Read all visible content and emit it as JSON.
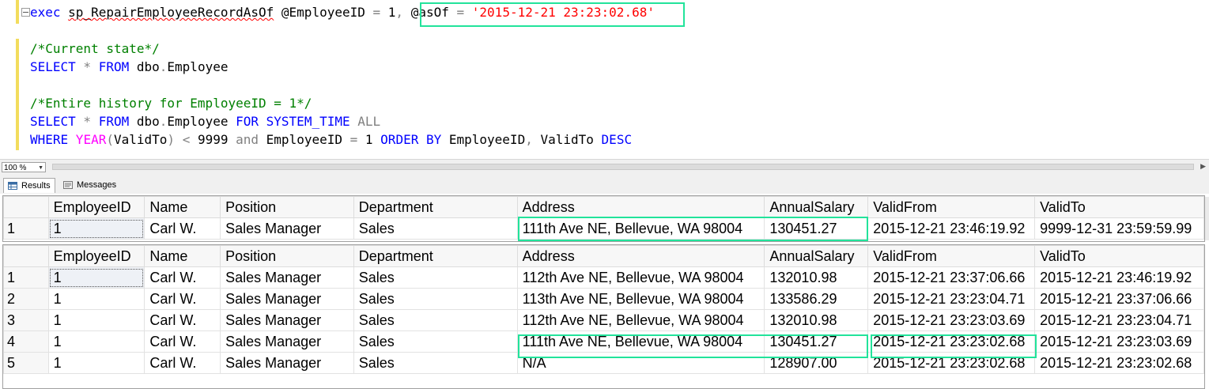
{
  "editor": {
    "line1": {
      "exec": "exec",
      "proc": "sp_RepairEmployeeRecordAsOf",
      "param1": "@EmployeeID",
      "eq1": " = ",
      "val1": "1",
      "comma": ",",
      "param2": "@asOf",
      "eq2": " = ",
      "val2": "'2015-12-21 23:23:02.68'"
    },
    "line3_comment": "/*Current state*/",
    "line4": {
      "select": "SELECT",
      "star": " * ",
      "from": "FROM",
      "table": " dbo",
      "dot": ".",
      "name": "Employee"
    },
    "line6_comment": "/*Entire history for EmployeeID = 1*/",
    "line7": {
      "select": "SELECT",
      "star": " * ",
      "from": "FROM",
      "table": " dbo",
      "dot": ".",
      "name": "Employee ",
      "for": "FOR",
      "systime": " SYSTEM_TIME ",
      "all": "ALL"
    },
    "line8": {
      "where": "WHERE",
      "year": " YEAR",
      "open": "(",
      "col": "ValidTo",
      "close": ") ",
      "lt": "<",
      "num": " 9999 ",
      "and": "and",
      "rest": " EmployeeID ",
      "eq": "=",
      "one": " 1 ",
      "orderby": "ORDER BY",
      "cols": " EmployeeID",
      "comma": ",",
      "col2": " ValidTo ",
      "desc": "DESC"
    }
  },
  "zoom": {
    "value": "100 %"
  },
  "tabs": {
    "results": "Results",
    "messages": "Messages"
  },
  "columns": [
    "EmployeeID",
    "Name",
    "Position",
    "Department",
    "Address",
    "AnnualSalary",
    "ValidFrom",
    "ValidTo"
  ],
  "grid1": {
    "rows": [
      {
        "rn": "1",
        "cells": [
          "1",
          "Carl W.",
          "Sales Manager",
          "Sales",
          "111th Ave NE, Bellevue, WA 98004",
          "130451.27",
          "2015-12-21 23:46:19.92",
          "9999-12-31 23:59:59.99"
        ]
      }
    ]
  },
  "grid2": {
    "rows": [
      {
        "rn": "1",
        "cells": [
          "1",
          "Carl W.",
          "Sales Manager",
          "Sales",
          "112th Ave NE, Bellevue, WA 98004",
          "132010.98",
          "2015-12-21 23:37:06.66",
          "2015-12-21 23:46:19.92"
        ]
      },
      {
        "rn": "2",
        "cells": [
          "1",
          "Carl W.",
          "Sales Manager",
          "Sales",
          "113th Ave NE, Bellevue, WA 98004",
          "133586.29",
          "2015-12-21 23:23:04.71",
          "2015-12-21 23:37:06.66"
        ]
      },
      {
        "rn": "3",
        "cells": [
          "1",
          "Carl W.",
          "Sales Manager",
          "Sales",
          "112th Ave NE, Bellevue, WA 98004",
          "132010.98",
          "2015-12-21 23:23:03.69",
          "2015-12-21 23:23:04.71"
        ]
      },
      {
        "rn": "4",
        "cells": [
          "1",
          "Carl W.",
          "Sales Manager",
          "Sales",
          "111th Ave NE, Bellevue, WA 98004",
          "130451.27",
          "2015-12-21 23:23:02.68",
          "2015-12-21 23:23:03.69"
        ]
      },
      {
        "rn": "5",
        "cells": [
          "1",
          "Carl W.",
          "Sales Manager",
          "Sales",
          "N/A",
          "128907.00",
          "2015-12-21 23:23:02.68",
          "2015-12-21 23:23:02.68"
        ]
      }
    ]
  },
  "colors": {
    "highlight": "#22e39b",
    "keyword": "#0000ff",
    "comment": "#008000",
    "string": "#ff0000",
    "function": "#ff00ff"
  },
  "icons": {
    "collapse": "minus-box-icon",
    "results": "grid-icon",
    "messages": "messages-icon"
  }
}
